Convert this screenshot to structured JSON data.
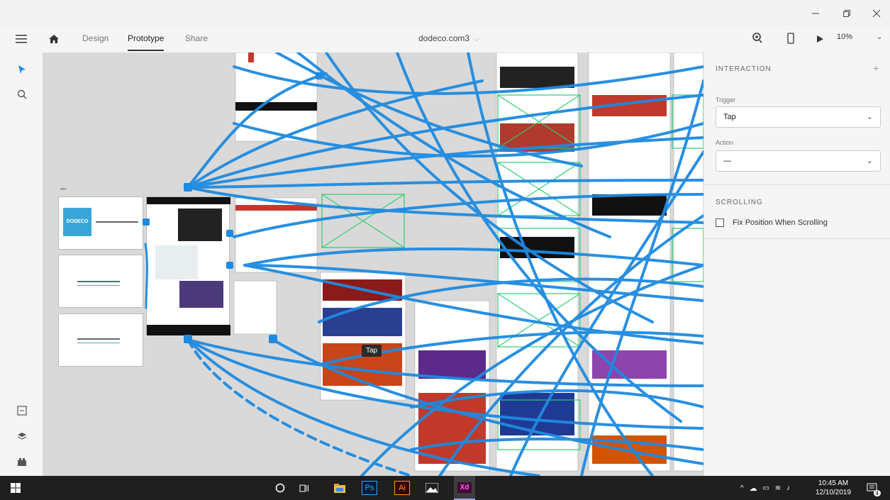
{
  "window": {
    "minimize_icon": "minimize-icon",
    "restore_icon": "restore-icon",
    "close_icon": "close-icon"
  },
  "toolbar": {
    "menu_icon": "hamburger-icon",
    "home_icon": "home-icon",
    "tabs": [
      {
        "label": "Design"
      },
      {
        "label": "Prototype"
      },
      {
        "label": "Share"
      }
    ],
    "document_title": "dodeco.com3",
    "zoom": "10%"
  },
  "canvas": {
    "artboard_labels": {
      "card_brand": "DODECO",
      "card_dots": "•••"
    },
    "tooltip": "Tap"
  },
  "panel": {
    "interaction_title": "INTERACTION",
    "add_symbol": "+",
    "trigger_label": "Trigger",
    "trigger_value": "Tap",
    "action_label": "Action",
    "action_value": "—",
    "scrolling_title": "SCROLLING",
    "fix_position_label": "Fix Position When Scrolling"
  },
  "taskbar": {
    "ps_label": "Ps",
    "ai_label": "Ai",
    "xd_label": "Xd",
    "time": "10:45 AM",
    "date": "12/10/2019",
    "notification_count": "4"
  },
  "colors": {
    "wire": "#1e8ae0",
    "xd_brand": "#470137",
    "ps_brand": "#31a8ff",
    "ai_brand": "#ff9a00"
  }
}
